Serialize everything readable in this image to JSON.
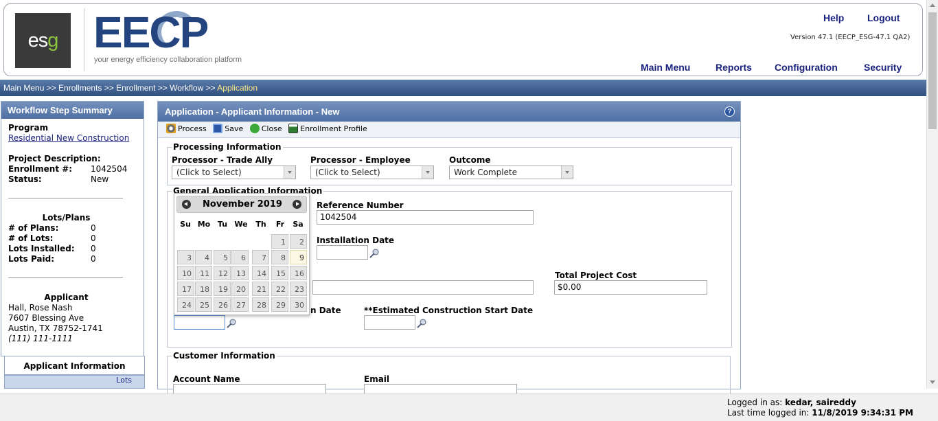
{
  "header": {
    "logo_text": "esg",
    "brand_word": "EECP",
    "tagline": "your energy efficiency collaboration platform",
    "help": "Help",
    "logout": "Logout",
    "version": "Version 47.1 (EECP_ESG-47.1 QA2)",
    "nav": [
      "Main Menu",
      "Reports",
      "Configuration",
      "Security"
    ]
  },
  "breadcrumb": {
    "trail": "Main Menu >> Enrollments >> Enrollment >> Workflow >> ",
    "current": "Application"
  },
  "left_panel": {
    "title": "Workflow Step Summary",
    "program_label": "Program",
    "program_link": "Residential New Construction",
    "project_description_label": "Project Description:",
    "enrollment_label": "Enrollment #:",
    "enrollment_value": "1042504",
    "status_label": "Status:",
    "status_value": "New",
    "lots_heading": "Lots/Plans",
    "lots": [
      {
        "label": "# of Plans:",
        "value": "0"
      },
      {
        "label": "# of Lots:",
        "value": "0"
      },
      {
        "label": "Lots Installed:",
        "value": "0"
      },
      {
        "label": "Lots Paid:",
        "value": "0"
      }
    ],
    "applicant_heading": "Applicant",
    "applicant_name": "Hall, Rose Nash",
    "applicant_address1": "7607 Blessing Ave",
    "applicant_address2": "Austin, TX 78752-1741",
    "applicant_phone": "(111) 111-1111",
    "tab_applicant_info": "Applicant Information",
    "tab_lots": "Lots"
  },
  "main_panel": {
    "title": "Application - Applicant Information - New",
    "help_icon_text": "?",
    "toolbar": [
      "Process",
      "Save",
      "Close",
      "Enrollment Profile"
    ],
    "processing": {
      "legend": "Processing Information",
      "trade_ally_label": "Processor - Trade Ally",
      "trade_ally_value": "(Click to Select)",
      "employee_label": "Processor - Employee",
      "employee_value": "(Click to Select)",
      "outcome_label": "Outcome",
      "outcome_value": "Work Complete"
    },
    "general": {
      "legend": "General Application Information",
      "reference_label": "Reference Number",
      "reference_value": "1042504",
      "installation_date_label": "Installation Date",
      "installation_date_value": "",
      "description_value": "",
      "total_cost_label": "Total Project Cost",
      "total_cost_value": "$0.00",
      "partial_date_label": "n Date",
      "partial_date_value": "",
      "est_start_label": "**Estimated Construction Start Date",
      "est_start_value": ""
    },
    "customer": {
      "legend": "Customer Information",
      "account_name_label": "Account Name",
      "email_label": "Email"
    }
  },
  "calendar": {
    "month_label": "November 2019",
    "days_of_week": [
      "Su",
      "Mo",
      "Tu",
      "We",
      "Th",
      "Fr",
      "Sa"
    ],
    "days": [
      "1",
      "2",
      "3",
      "4",
      "5",
      "6",
      "7",
      "8",
      "9",
      "10",
      "11",
      "12",
      "13",
      "14",
      "15",
      "16",
      "17",
      "18",
      "19",
      "20",
      "21",
      "22",
      "23",
      "24",
      "25",
      "26",
      "27",
      "28",
      "29",
      "30"
    ],
    "today": "9"
  },
  "footer": {
    "logged_in_label": "Logged in as:",
    "logged_in_user": "kedar, saireddy",
    "last_login_label": "Last time logged in:",
    "last_login_value": "11/8/2019 9:34:31 PM"
  },
  "colors": {
    "brand_blue": "#23447f",
    "panel_header": "#4e6fa3",
    "breadcrumb_current": "#ffe58a",
    "logo_green": "#8cc63f"
  }
}
